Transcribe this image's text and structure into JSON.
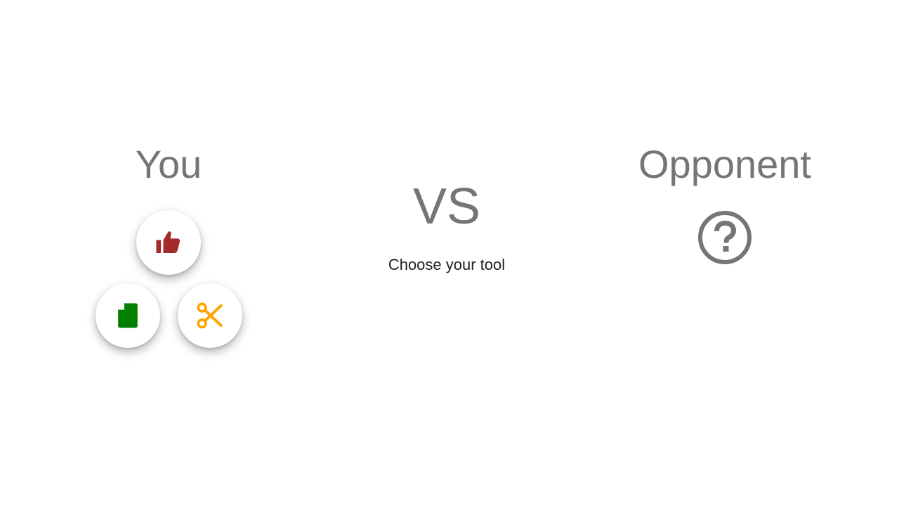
{
  "player": {
    "title": "You",
    "tools": [
      {
        "id": "rock",
        "icon": "thumbs-up-icon",
        "color": "#a52a2a"
      },
      {
        "id": "paper",
        "icon": "file-icon",
        "color": "#008000"
      },
      {
        "id": "scissors",
        "icon": "scissors-icon",
        "color": "#ffa500"
      }
    ]
  },
  "vs": {
    "label": "VS",
    "prompt": "Choose your tool"
  },
  "opponent": {
    "title": "Opponent",
    "icon": "question-circle-icon",
    "icon_color": "#757575"
  }
}
